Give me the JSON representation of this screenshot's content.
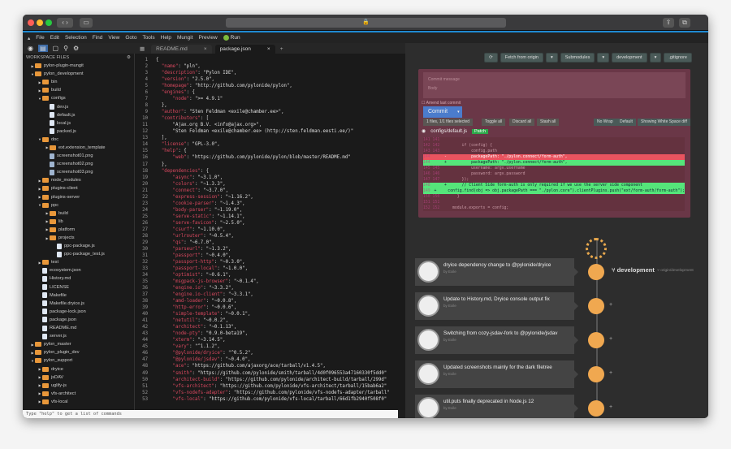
{
  "window": {
    "address": "",
    "traffic": [
      "#fe5f57",
      "#febc2e",
      "#28c840"
    ]
  },
  "menu": [
    "File",
    "Edit",
    "Selection",
    "Find",
    "View",
    "Goto",
    "Tools",
    "Help",
    "Mungit",
    "Preview"
  ],
  "run_label": "Run",
  "tabs": [
    {
      "label": "README.md"
    },
    {
      "label": "package.json"
    }
  ],
  "sidebar": {
    "title": "WORKSPACE FILES",
    "tree": [
      [
        "pylon-plugin-mungit",
        1,
        "folder",
        "c"
      ],
      [
        "pylon_development",
        1,
        "folder",
        "o"
      ],
      [
        "bin",
        2,
        "folder",
        "c"
      ],
      [
        "build",
        2,
        "folder",
        "c"
      ],
      [
        "configs",
        2,
        "folder",
        "o"
      ],
      [
        "dev.js",
        3,
        "file",
        ""
      ],
      [
        "default.js",
        3,
        "file",
        ""
      ],
      [
        "local.js",
        3,
        "file",
        ""
      ],
      [
        "packed.js",
        3,
        "file",
        ""
      ],
      [
        "doc",
        2,
        "folder",
        "o"
      ],
      [
        "ext.extension_template",
        3,
        "folder",
        "c"
      ],
      [
        "screenshot01.png",
        3,
        "img",
        ""
      ],
      [
        "screenshot02.png",
        3,
        "img",
        ""
      ],
      [
        "screenshot03.png",
        3,
        "img",
        ""
      ],
      [
        "node_modules",
        2,
        "folder",
        "c"
      ],
      [
        "plugins-client",
        2,
        "folder",
        "c"
      ],
      [
        "plugins-server",
        2,
        "folder",
        "c"
      ],
      [
        "ppc",
        2,
        "folder",
        "o"
      ],
      [
        "build",
        3,
        "folder",
        "c"
      ],
      [
        "lib",
        3,
        "folder",
        "c"
      ],
      [
        "platform",
        3,
        "folder",
        "c"
      ],
      [
        "projects",
        3,
        "folder",
        "c"
      ],
      [
        "ppc-package.js",
        4,
        "file",
        ""
      ],
      [
        "ppc-package_test.js",
        4,
        "file",
        ""
      ],
      [
        "test",
        2,
        "folder",
        "c"
      ],
      [
        "ecosystem.json",
        2,
        "file",
        ""
      ],
      [
        "History.md",
        2,
        "file",
        ""
      ],
      [
        "LICENSE",
        2,
        "file",
        ""
      ],
      [
        "Makefile",
        2,
        "file",
        ""
      ],
      [
        "Makefile.dryice.js",
        2,
        "file",
        ""
      ],
      [
        "package-lock.json",
        2,
        "file",
        ""
      ],
      [
        "package.json",
        2,
        "file",
        ""
      ],
      [
        "README.md",
        2,
        "file",
        ""
      ],
      [
        "server.js",
        2,
        "file",
        ""
      ],
      [
        "pylon_master",
        1,
        "folder",
        "c"
      ],
      [
        "pylon_plugin_dev",
        1,
        "folder",
        "c"
      ],
      [
        "pylon_support",
        1,
        "folder",
        "o"
      ],
      [
        "dryice",
        2,
        "folder",
        "c"
      ],
      [
        "jsDAV",
        2,
        "folder",
        "c"
      ],
      [
        "uglify-js",
        2,
        "folder",
        "c"
      ],
      [
        "vfs-architect",
        2,
        "folder",
        "c"
      ],
      [
        "vfs-local",
        2,
        "folder",
        "c"
      ]
    ]
  },
  "code": [
    [
      "",
      "{"
    ],
    [
      "  \"name\"",
      ": \"pln\","
    ],
    [
      "  \"description\"",
      ": \"Pylon IDE\","
    ],
    [
      "  \"version\"",
      ": \"2.5.0\","
    ],
    [
      "  \"homepage\"",
      ": \"http://github.com/pylonide/pylon\","
    ],
    [
      "  \"engines\"",
      ": {"
    ],
    [
      "      \"node\"",
      ": \">= 4.9.1\""
    ],
    [
      "",
      "  },"
    ],
    [
      "  \"author\"",
      ": \"Sten Feldman <exile@chamber.ee>\","
    ],
    [
      "  \"contributors\"",
      ": ["
    ],
    [
      "",
      "      \"Ajax.org B.V. <info@ajax.org>\","
    ],
    [
      "",
      "      \"Sten Feldman <exile@chamber.ee> (http://sten.feldman.eesti.ee/)\""
    ],
    [
      "",
      "  ],"
    ],
    [
      "  \"license\"",
      ": \"GPL-3.0\","
    ],
    [
      "  \"help\"",
      ": {"
    ],
    [
      "      \"web\"",
      ": \"https://github.com/pylonide/pylon/blob/master/README.md\""
    ],
    [
      "",
      "  },"
    ],
    [
      "  \"dependencies\"",
      ": {"
    ],
    [
      "      \"async\"",
      ": \"~3.1.0\","
    ],
    [
      "      \"colors\"",
      ": \"~1.3.3\","
    ],
    [
      "      \"connect\"",
      ": \"~3.7.0\","
    ],
    [
      "      \"express-session\"",
      ": \"~1.16.2\","
    ],
    [
      "      \"cookie-parser\"",
      ": \"~1.4.3\","
    ],
    [
      "      \"body-parser\"",
      ": \"~1.19.0\","
    ],
    [
      "      \"serve-static\"",
      ": \"~1.14.1\","
    ],
    [
      "      \"serve-favicon\"",
      ": \"~2.5.0\","
    ],
    [
      "      \"csurf\"",
      ": \"~1.10.0\","
    ],
    [
      "      \"urlrouter\"",
      ": \"~0.5.4\","
    ],
    [
      "      \"qs\"",
      ": \"~6.7.0\","
    ],
    [
      "      \"parseurl\"",
      ": \"~1.3.2\","
    ],
    [
      "      \"passport\"",
      ": \"~0.4.0\","
    ],
    [
      "      \"passport-http\"",
      ": \"~0.3.0\","
    ],
    [
      "      \"passport-local\"",
      ": \"~1.0.0\","
    ],
    [
      "      \"optimist\"",
      ": \"~0.6.1\","
    ],
    [
      "      \"msgpack-js-browser\"",
      ": \"~0.1.4\","
    ],
    [
      "      \"engine.io\"",
      ": \"~3.3.2\","
    ],
    [
      "      \"engine.io-client\"",
      ": \"~3.3.1\","
    ],
    [
      "      \"amd-loader\"",
      ": \"~0.0.8\","
    ],
    [
      "      \"http-error\"",
      ": \"~0.0.6\","
    ],
    [
      "      \"simple-template\"",
      ": \"~0.0.1\","
    ],
    [
      "      \"netutil\"",
      ": \"~0.0.2\","
    ],
    [
      "      \"architect\"",
      ": \"~0.1.13\","
    ],
    [
      "      \"node-pty\"",
      ": \"0.9.0-beta19\","
    ],
    [
      "      \"xterm\"",
      ": \"~3.14.5\","
    ],
    [
      "      \"vary\"",
      ": \"^1.1.2\","
    ],
    [
      "      \"@pylonide/dryice\"",
      ": \"^0.5.2\","
    ],
    [
      "      \"@pylonide/jsdav\"",
      ": \"~0.4.0\","
    ],
    [
      "      \"ace\"",
      ": \"https://github.com/ajaxorg/ace/tarball/v1.4.5\","
    ],
    [
      "      \"smith\"",
      ": \"https://github.com/pylonide/smith/tarball/4d0f096553a47160330f5dd0\""
    ],
    [
      "      \"architect-build\"",
      ": \"https://github.com/pylonide/architect-build/tarball/299d\""
    ],
    [
      "      \"vfs-architect\"",
      ": \"https://github.com/pylonide/vfs-architect/tarball/15bab6a2\""
    ],
    [
      "      \"vfs-nodefs-adapter\"",
      ": \"https://github.com/pylonide/vfs-nodefs-adapter/tarball\""
    ],
    [
      "      \"vfs-local\"",
      ": \"https://github.com/pylonide/vfs-local/tarball/66d1fb2940f508f0\""
    ]
  ],
  "command_placeholder": "Type \"help\" to get a list of commands",
  "git": {
    "toolbar": [
      "Fetch from origin",
      "Submodules",
      "development",
      ".gitignore"
    ],
    "commit_placeholder": "Commit message",
    "commit_body": "Body",
    "amend": "Amend last commit",
    "commit_label": "Commit",
    "stage_row": [
      "1 files, 1/1 files selected",
      "Toggle all",
      "Discard all",
      "Stash all"
    ],
    "diff_opts": [
      "No Wrap",
      "Default",
      "Showing White Space diff"
    ],
    "file": "configs/default.js",
    "patch": "Patch",
    "diff": [
      [
        "141 141",
        "",
        ""
      ],
      [
        "142 142",
        "",
        "    if (config) {"
      ],
      [
        "143 143",
        "",
        "        config.path"
      ],
      [
        "144",
        "-",
        "        packagePath: \"./pylon.connect/form-auth\","
      ],
      [
        "144",
        "+",
        "        packagePath: \"./pylon.connect/form-auth\","
      ],
      [
        "145 145",
        "",
        "        username: argv.username"
      ],
      [
        "146 146",
        "",
        "        password: argv.password"
      ],
      [
        "147 147",
        "",
        "    });"
      ],
      [
        "148",
        "+",
        "    // Client Side form-auth is only required if we use the server side component"
      ],
      [
        "149",
        "+",
        "    config.find(obj => obj.packagePath === \"./pylon.core\").clientPlugins.push(\"ext/form-auth/form-auth\");"
      ],
      [
        "150 150",
        "",
        "  }"
      ],
      [
        "151 151",
        "",
        ""
      ],
      [
        "152 152",
        "",
        "module.exports = config;"
      ]
    ],
    "branch": "development",
    "origin": "origin/development",
    "commits": [
      {
        "title": "dryice dependency change to @pylonide/dryice",
        "author": "by Exile"
      },
      {
        "title": "Update to History.md, Dryice console output fix",
        "author": "by Exile"
      },
      {
        "title": "Switching from cozy-jsdav-fork to @pylonide/jsdav",
        "author": "by Exile"
      },
      {
        "title": "Updated screenshots mainly for the dark filetree",
        "author": "by Exile"
      },
      {
        "title": "util.puts finally deprecated in Node.js 12",
        "author": "by Exile"
      }
    ]
  }
}
